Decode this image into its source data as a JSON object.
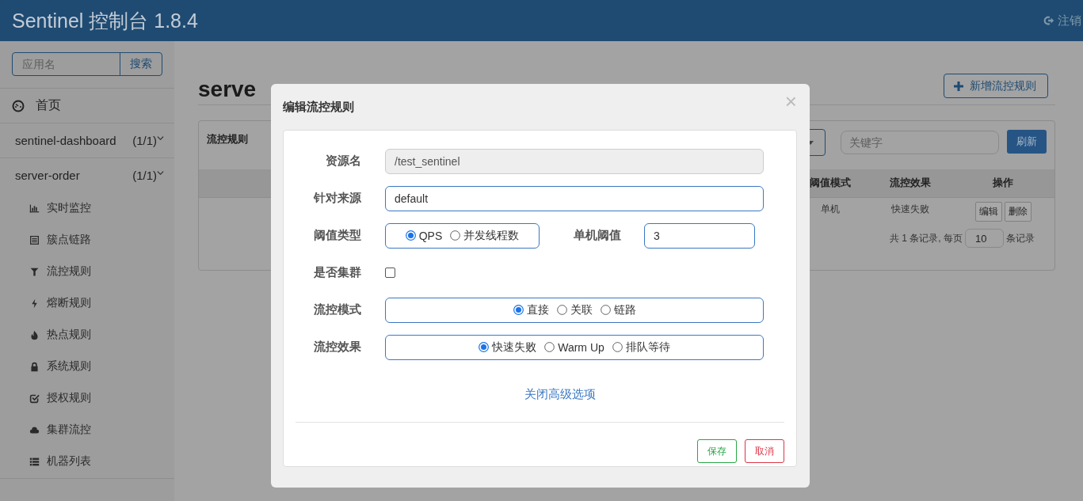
{
  "header": {
    "title": "Sentinel 控制台 1.8.4",
    "logout": "注销"
  },
  "sidebar": {
    "search": {
      "placeholder": "应用名",
      "button": "搜索"
    },
    "home": "首页",
    "apps": [
      {
        "name": "sentinel-dashboard",
        "count": "(1/1)"
      },
      {
        "name": "server-order",
        "count": "(1/1)",
        "children": [
          {
            "label": "实时监控"
          },
          {
            "label": "簇点链路"
          },
          {
            "label": "流控规则"
          },
          {
            "label": "熔断规则"
          },
          {
            "label": "热点规则"
          },
          {
            "label": "系统规则"
          },
          {
            "label": "授权规则"
          },
          {
            "label": "集群流控"
          },
          {
            "label": "机器列表"
          }
        ]
      }
    ]
  },
  "main": {
    "title": "serve",
    "add_button": "新增流控规则",
    "panel": {
      "title": "流控规则",
      "search": {
        "placeholder": "关键字"
      },
      "refresh": "刷新",
      "table": {
        "columns": [
          "阈值模式",
          "流控效果",
          "操作"
        ],
        "rows": [
          {
            "cells": [
              "单机",
              "快速失败"
            ],
            "actions": [
              "编辑",
              "删除"
            ]
          }
        ]
      },
      "pager": {
        "before": "共 1 条记录, 每页",
        "page_size": "10",
        "after": "条记录"
      }
    }
  },
  "modal": {
    "title": "编辑流控规则",
    "close": "×",
    "fields": [
      {
        "kind": "text",
        "label": "资源名",
        "value": "/test_sentinel",
        "disabled": true
      },
      {
        "kind": "text",
        "label": "针对来源",
        "value": "default",
        "disabled": false
      },
      {
        "kind": "threshold",
        "label": "阈值类型",
        "options": [
          {
            "label": "QPS",
            "selected": true
          },
          {
            "label": "并发线程数",
            "selected": false
          }
        ],
        "extra_label": "单机阈值",
        "extra_value": "3"
      },
      {
        "kind": "checkbox",
        "label": "是否集群",
        "checked": false
      },
      {
        "kind": "radio",
        "label": "流控模式",
        "options": [
          {
            "label": "直接",
            "selected": true
          },
          {
            "label": "关联",
            "selected": false
          },
          {
            "label": "链路",
            "selected": false
          }
        ]
      },
      {
        "kind": "radio",
        "label": "流控效果",
        "options": [
          {
            "label": "快速失败",
            "selected": true
          },
          {
            "label": "Warm Up",
            "selected": false
          },
          {
            "label": "排队等待",
            "selected": false
          }
        ]
      }
    ],
    "toggle_link": "关闭高级选项",
    "buttons": [
      {
        "kind": "save",
        "label": "保存"
      },
      {
        "kind": "cancel",
        "label": "取消"
      }
    ]
  }
}
